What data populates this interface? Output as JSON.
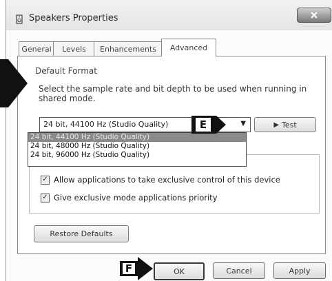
{
  "window": {
    "title": "Speakers Properties"
  },
  "tabs": [
    {
      "label": "General"
    },
    {
      "label": "Levels"
    },
    {
      "label": "Enhancements"
    },
    {
      "label": "Advanced"
    }
  ],
  "default_format": {
    "group_label": "Default Format",
    "description": "Select the sample rate and bit depth to be used when running in shared mode.",
    "selected_value": "24 bit, 44100 Hz (Studio Quality)",
    "options": [
      "24 bit, 44100 Hz (Studio Quality)",
      "24 bit, 48000 Hz (Studio Quality)",
      "24 bit, 96000 Hz (Studio Quality)"
    ],
    "test_label": "Test"
  },
  "exclusive": {
    "partial_label": "E",
    "allow_label": "Allow applications to take exclusive control of this device",
    "allow_checked": true,
    "priority_label": "Give exclusive mode applications priority",
    "priority_checked": true
  },
  "restore_label": "Restore Defaults",
  "buttons": {
    "ok": "OK",
    "cancel": "Cancel",
    "apply": "Apply"
  },
  "markers": {
    "e": "E",
    "f": "F"
  }
}
